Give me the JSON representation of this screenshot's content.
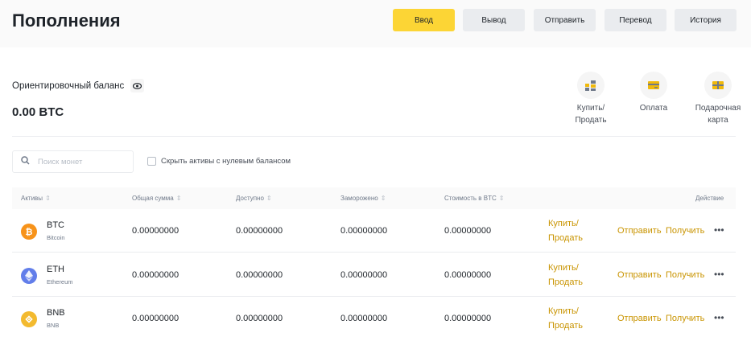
{
  "header": {
    "title": "Пополнения",
    "buttons": [
      "Ввод",
      "Вывод",
      "Отправить",
      "Перевод",
      "История"
    ],
    "accent_color": "#fcd535"
  },
  "balance": {
    "label": "Ориентировочный баланс",
    "value": "0.00 BTC"
  },
  "actions": [
    {
      "label": "Купить/\nПродать",
      "icon": "buy-sell-icon"
    },
    {
      "label": "Оплата",
      "icon": "payment-card-icon"
    },
    {
      "label": "Подарочная\nкарта",
      "icon": "gift-card-icon"
    }
  ],
  "filters": {
    "search_placeholder": "Поиск монет",
    "hide_zero_label": "Скрыть активы с нулевым балансом"
  },
  "table": {
    "headers": [
      "Активы",
      "Общая сумма",
      "Доступно",
      "Заморожено",
      "Стоимость в BTC",
      "Действие"
    ],
    "rows": [
      {
        "symbol": "BTC",
        "name": "Bitcoin",
        "total": "0.00000000",
        "available": "0.00000000",
        "frozen": "0.00000000",
        "btc_value": "0.00000000",
        "color": "#f7931a"
      },
      {
        "symbol": "ETH",
        "name": "Ethereum",
        "total": "0.00000000",
        "available": "0.00000000",
        "frozen": "0.00000000",
        "btc_value": "0.00000000",
        "color": "#627eea"
      },
      {
        "symbol": "BNB",
        "name": "BNB",
        "total": "0.00000000",
        "available": "0.00000000",
        "frozen": "0.00000000",
        "btc_value": "0.00000000",
        "color": "#f3ba2f"
      }
    ],
    "row_actions": {
      "buy_sell_line1": "Купить/",
      "buy_sell_line2": "Продать",
      "send": "Отправить",
      "receive": "Получить",
      "more": "•••"
    }
  }
}
